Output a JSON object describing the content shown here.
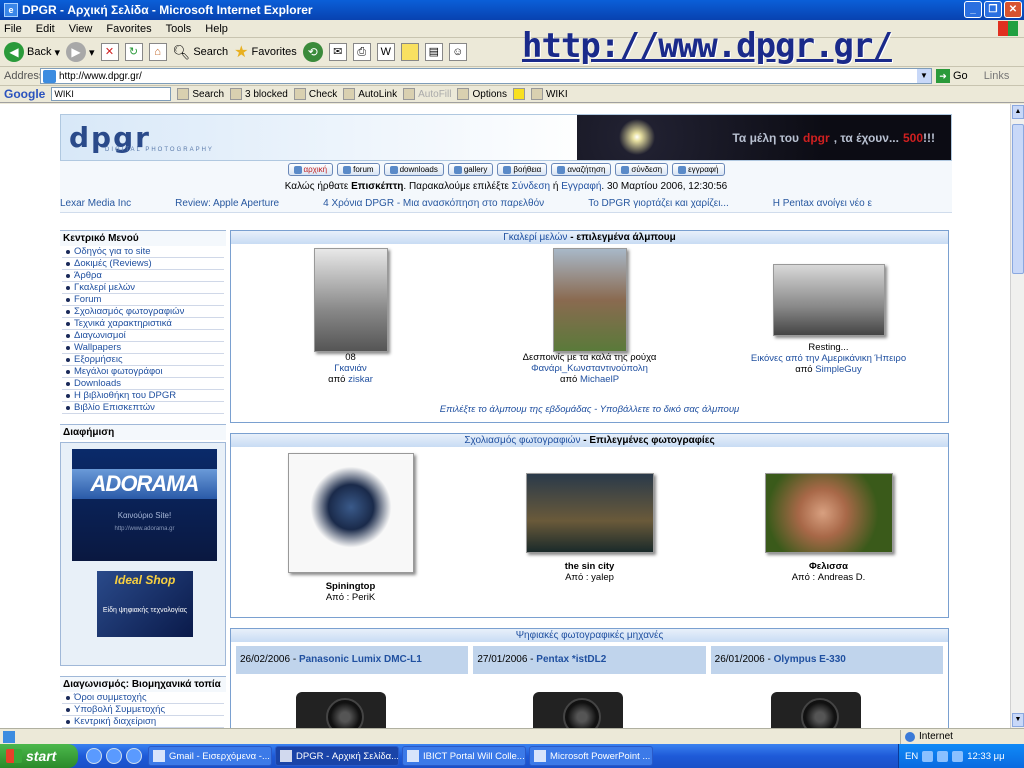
{
  "window": {
    "title": "DPGR - Αρχική Σελίδα - Microsoft Internet Explorer"
  },
  "menu": [
    "File",
    "Edit",
    "View",
    "Favorites",
    "Tools",
    "Help"
  ],
  "toolbar": {
    "back": "Back",
    "search": "Search",
    "favorites": "Favorites"
  },
  "overlay_url": "http://www.dpgr.gr/",
  "address": {
    "label": "Address",
    "value": "http://www.dpgr.gr/",
    "go": "Go",
    "links": "Links"
  },
  "google_toolbar": {
    "logo": "Google",
    "query": "WIKI",
    "search": "Search",
    "blocked": "3 blocked",
    "check": "Check",
    "autolink": "AutoLink",
    "autofill": "AutoFill",
    "options": "Options",
    "wiki": "WIKI"
  },
  "site": {
    "logo": "dpgr",
    "logo_sub": "DIGITAL PHOTOGRAPHY",
    "members_text_1": "Τα μέλη του",
    "members_brand": "dpgr",
    "members_text_2": ", τα έχουν...",
    "members_count": "500",
    "members_suffix": "!!!",
    "nav": [
      {
        "label": "αρχική",
        "active": true
      },
      {
        "label": "forum"
      },
      {
        "label": "downloads"
      },
      {
        "label": "gallery"
      },
      {
        "label": "βοήθεια"
      },
      {
        "label": "αναζήτηση"
      },
      {
        "label": "σύνδεση"
      },
      {
        "label": "εγγραφή"
      }
    ],
    "welcome": {
      "pre": "Καλώς ήρθατε",
      "user": "Επισκέπτη",
      "mid": ". Παρακαλούμε επιλέξτε",
      "login": "Σύνδεση",
      "or": "ή",
      "register": "Εγγραφή",
      "date": ". 30 Μαρτίου 2006, 12:30:56"
    },
    "ticker": [
      "Lexar Media Inc",
      "Review: Apple Aperture",
      "4 Χρόνια DPGR - Μια ανασκόπηση στο παρελθόν",
      "Το DPGR γιορτάζει και χαρίζει...",
      "Η Pentax ανοίγει νέο ε"
    ],
    "left_menu": {
      "title": "Κεντρικό Μενού",
      "items": [
        "Οδηγός για το site",
        "Δοκιμές (Reviews)",
        "Άρθρα",
        "Γκαλερί μελών",
        "Forum",
        "Σχολιασμός φωτογραφιών",
        "Τεχνικά χαρακτηριστικά",
        "Διαγωνισμοί",
        "Wallpapers",
        "Εξορμήσεις",
        "Μεγάλοι φωτογράφοι",
        "Downloads",
        "Η βιβλιοθήκη του DPGR",
        "Βιβλίο Επισκεπτών"
      ]
    },
    "ads": {
      "title": "Διαφήμιση",
      "adorama": "ADORAMA",
      "adorama_sub": "Καινούριο Site!",
      "adorama_url": "http://www.adorama.gr",
      "ideal": "Ideal Shop",
      "ideal_sub": "Είδη ψηφιακής τεχνολογίας"
    },
    "contest": {
      "title": "Διαγωνισμός: Βιομηχανικά τοπία",
      "items": [
        "Όροι συμμετοχής",
        "Υποβολή Συμμετοχής",
        "Κεντρική διαχείριση"
      ]
    },
    "gallery": {
      "title_link": "Γκαλερί μελών",
      "title_rest": " - επιλεγμένα άλμπουμ",
      "items": [
        {
          "name": "08",
          "album": "Γκανιάν",
          "by": "από",
          "user": "ziskar"
        },
        {
          "name": "Δεσποινίς με τα καλά της ρούχα",
          "album": "Φανάρι_Κωνσταντινούπολη",
          "by": "από",
          "user": "MichaelP"
        },
        {
          "name": "Resting...",
          "album": "Εικόνες από την Αμερικάνικη Ήπειρο",
          "by": "από",
          "user": "SimpleGuy"
        }
      ],
      "foot_1": "Επιλέξτε το άλμπουμ της εβδομάδας",
      "foot_sep": " - ",
      "foot_2": "Υποβάλλετε το δικό σας άλμπουμ"
    },
    "critique": {
      "title_link": "Σχολιασμός φωτογραφιών",
      "title_rest": " - Επιλεγμένες φωτογραφίες",
      "items": [
        {
          "name": "Spiningtop",
          "by": "Από : PeriK"
        },
        {
          "name": "the sin city",
          "by": "Από : yalep"
        },
        {
          "name": "Φελισσα",
          "by": "Από : Andreas D."
        }
      ]
    },
    "cameras": {
      "title": "Ψηφιακές φωτογραφικές μηχανές",
      "items": [
        {
          "date": "26/02/2006 -",
          "model": "Panasonic Lumix DMC-L1"
        },
        {
          "date": "27/01/2006 -",
          "model": "Pentax *istDL2"
        },
        {
          "date": "26/01/2006 -",
          "model": "Olympus E-330"
        }
      ]
    }
  },
  "status": {
    "zone": "Internet"
  },
  "taskbar": {
    "start": "start",
    "tasks": [
      "Gmail - Εισερχόμενα -...",
      "DPGR - Αρχική Σελίδα...",
      "IBICT Portal Will Colle...",
      "Microsoft PowerPoint ..."
    ],
    "lang": "EN",
    "clock": "12:33 μμ"
  }
}
